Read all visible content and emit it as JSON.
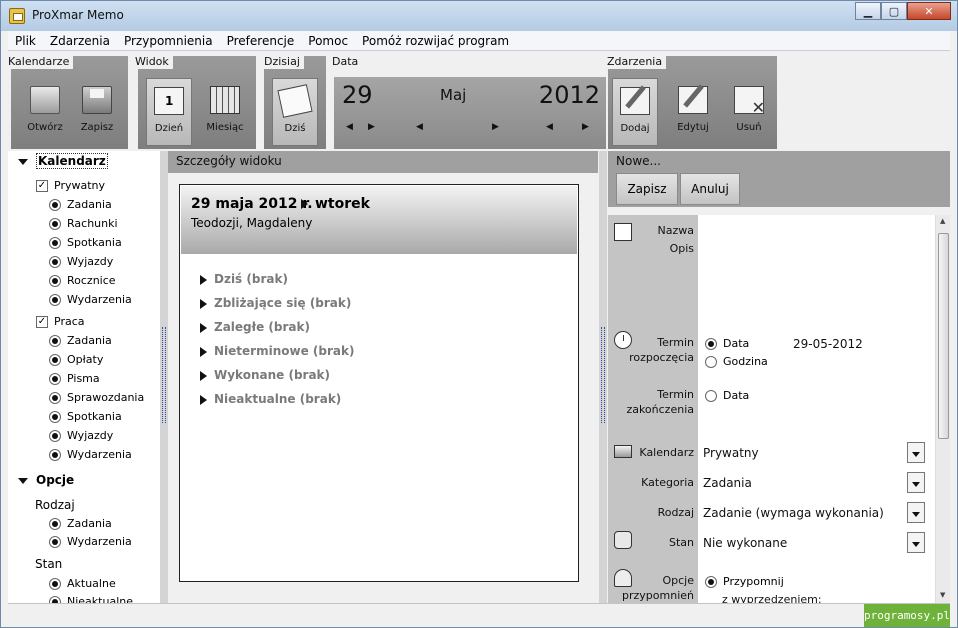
{
  "window": {
    "title": "ProXmar Memo"
  },
  "menu": [
    "Plik",
    "Zdarzenia",
    "Przypomnienia",
    "Preferencje",
    "Pomoc",
    "Pomóż rozwijać program"
  ],
  "toolbar": {
    "kalendarze_label": "Kalendarze",
    "widok_label": "Widok",
    "dzisiaj_label": "Dzisiaj",
    "data_label": "Data",
    "zdarzenia_label": "Zdarzenia",
    "otworz": "Otwórz",
    "zapisz": "Zapisz",
    "dzien": "Dzień",
    "miesiac": "Miesiąc",
    "dzis": "Dziś",
    "dodaj": "Dodaj",
    "edytuj": "Edytuj",
    "usun": "Usuń"
  },
  "date_picker": {
    "day": "29",
    "month": "Maj",
    "year": "2012"
  },
  "sidebar": {
    "kalendarz_heading": "Kalendarz",
    "prywatny": {
      "label": "Prywatny",
      "items": [
        "Zadania",
        "Rachunki",
        "Spotkania",
        "Wyjazdy",
        "Rocznice",
        "Wydarzenia"
      ]
    },
    "praca": {
      "label": "Praca",
      "items": [
        "Zadania",
        "Opłaty",
        "Pisma",
        "Sprawozdania",
        "Spotkania",
        "Wyjazdy",
        "Wydarzenia"
      ]
    },
    "opcje_heading": "Opcje",
    "rodzaj_label": "Rodzaj",
    "rodzaj_items": [
      "Zadania",
      "Wydarzenia"
    ],
    "stan_label": "Stan",
    "stan_items": [
      "Aktualne",
      "Nieaktualne"
    ]
  },
  "center": {
    "header": "Szczegóły widoku",
    "date": "29 maja 2012 r.",
    "weekday": "wtorek",
    "names": "Teodozji, Magdaleny",
    "sections": [
      "Dziś (brak)",
      "Zbliżające się (brak)",
      "Zaległe (brak)",
      "Nieterminowe (brak)",
      "Wykonane (brak)",
      "Nieaktualne (brak)"
    ]
  },
  "editor": {
    "title": "Nowe...",
    "save": "Zapisz",
    "cancel": "Anuluj",
    "labels": {
      "nazwa": "Nazwa",
      "opis": "Opis",
      "termin_rozpoczecia": "Termin\nrozpoczęcia",
      "termin_zakonczenia": "Termin\nzakończenia",
      "kalendarz": "Kalendarz",
      "kategoria": "Kategoria",
      "rodzaj": "Rodzaj",
      "stan": "Stan",
      "opcje_przypomnien": "Opcje\nprzypomnień"
    },
    "start_data_option": "Data",
    "start_godzina_option": "Godzina",
    "start_date_value": "29-05-2012",
    "end_data_option": "Data",
    "kalendarz_value": "Prywatny",
    "kategoria_value": "Zadania",
    "rodzaj_value": "Zadanie (wymaga wykonania)",
    "stan_value": "Nie wykonane",
    "przypomnij_option": "Przypomnij",
    "przypomnij_sub": "z wyprzedzeniem:"
  },
  "watermark": "programosy.pl"
}
